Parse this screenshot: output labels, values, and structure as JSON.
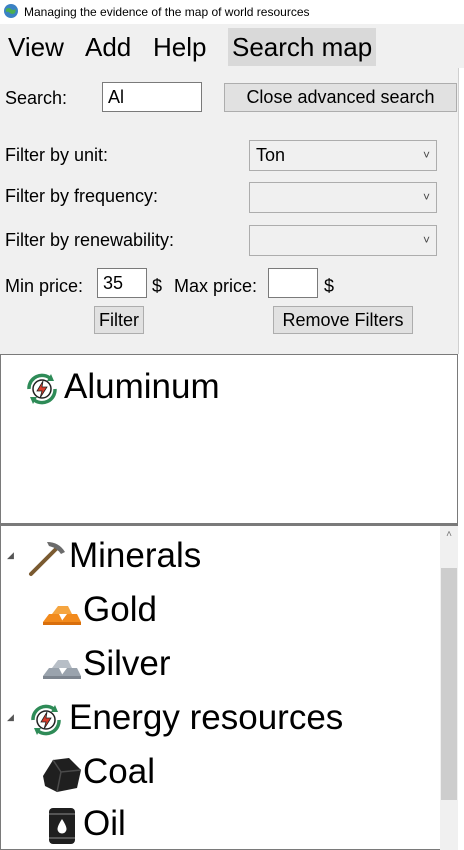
{
  "window": {
    "title": "Managing the evidence of the map of world resources"
  },
  "menu": {
    "items": [
      "View",
      "Add",
      "Help",
      "Search map"
    ],
    "active_index": 3
  },
  "search": {
    "label": "Search:",
    "value": "Al",
    "close_button": "Close advanced search"
  },
  "filters": {
    "unit_label": "Filter by unit:",
    "unit_value": "Ton",
    "frequency_label": "Filter by frequency:",
    "frequency_value": "",
    "renewability_label": "Filter by renewability:",
    "renewability_value": "",
    "min_price_label": "Min price:",
    "min_price_value": "35",
    "currency_1": "$",
    "max_price_label": "Max price:",
    "max_price_value": "",
    "currency_2": "$",
    "filter_button": "Filter",
    "remove_button": "Remove Filters"
  },
  "results": {
    "items": [
      {
        "label": "Aluminum",
        "icon": "renewable-energy-icon"
      }
    ]
  },
  "tree": {
    "categories": [
      {
        "label": "Minerals",
        "icon": "pickaxe-icon",
        "children": [
          {
            "label": "Gold",
            "icon": "gold-bars-icon"
          },
          {
            "label": "Silver",
            "icon": "silver-bars-icon"
          }
        ]
      },
      {
        "label": "Energy  resources",
        "icon": "renewable-energy-icon",
        "children": [
          {
            "label": "Coal",
            "icon": "coal-icon"
          },
          {
            "label": "Oil",
            "icon": "oil-barrel-icon"
          }
        ]
      }
    ]
  },
  "colors": {
    "chrome_bg": "#f0f0f0",
    "active_menu_bg": "#d9d9d9",
    "gold": "#f28a1c",
    "silver": "#9aa3ad",
    "energy_green": "#2e8b57",
    "energy_red": "#d93b2b"
  }
}
